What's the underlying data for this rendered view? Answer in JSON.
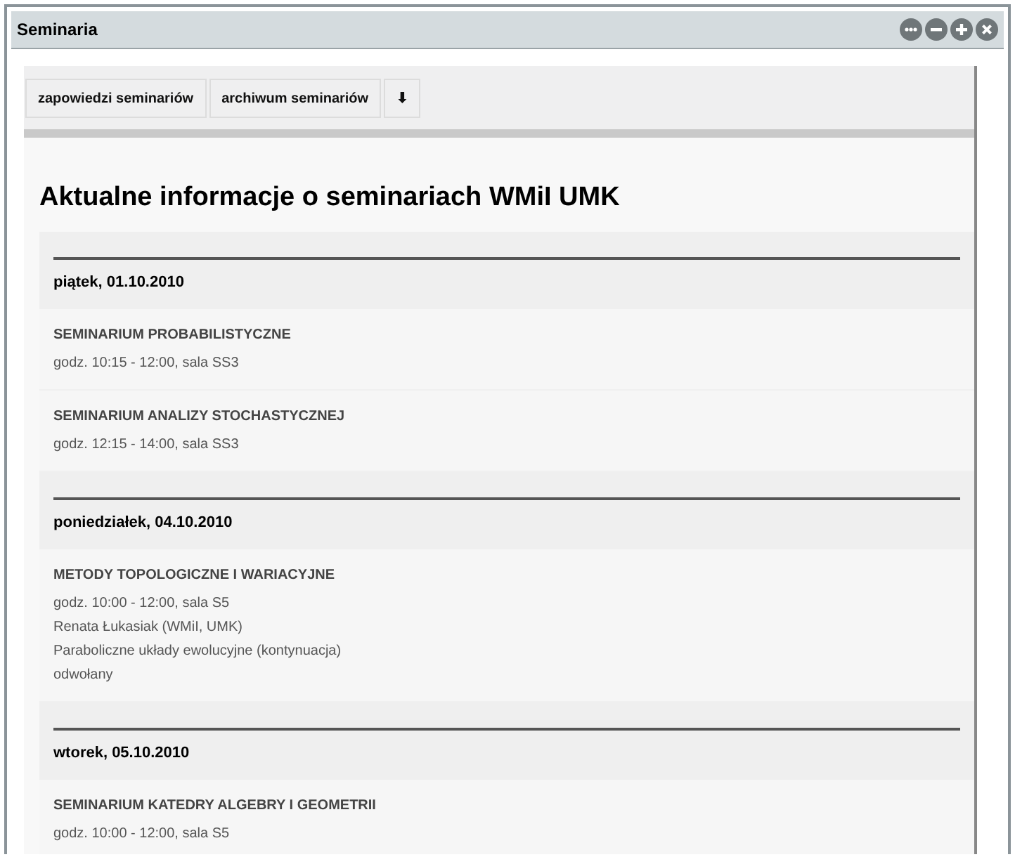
{
  "window": {
    "title": "Seminaria"
  },
  "title_buttons": [
    {
      "kind": "more"
    },
    {
      "kind": "minimize"
    },
    {
      "kind": "maximize"
    },
    {
      "kind": "close"
    }
  ],
  "tabs": [
    {
      "label": "zapowiedzi seminariów"
    },
    {
      "label": "archiwum seminariów"
    },
    {
      "label": "⬇"
    }
  ],
  "heading": "Aktualne informacje o seminariach WMiI UMK",
  "days": [
    {
      "date": "piątek, 01.10.2010",
      "events": [
        {
          "title": "SEMINARIUM PROBABILISTYCZNE",
          "lines": [
            "godz. 10:15 - 12:00, sala SS3"
          ]
        },
        {
          "title": "SEMINARIUM ANALIZY STOCHASTYCZNEJ",
          "lines": [
            "godz. 12:15 - 14:00, sala SS3"
          ]
        }
      ]
    },
    {
      "date": "poniedziałek, 04.10.2010",
      "events": [
        {
          "title": "METODY TOPOLOGICZNE I WARIACYJNE",
          "lines": [
            "godz. 10:00 - 12:00, sala S5",
            "Renata Łukasiak (WMiI, UMK)",
            "Paraboliczne układy ewolucyjne (kontynuacja)",
            "odwołany"
          ]
        }
      ]
    },
    {
      "date": "wtorek, 05.10.2010",
      "events": [
        {
          "title": "SEMINARIUM KATEDRY ALGEBRY I GEOMETRII",
          "lines": [
            "godz. 10:00 - 12:00, sala S5"
          ]
        }
      ]
    }
  ]
}
